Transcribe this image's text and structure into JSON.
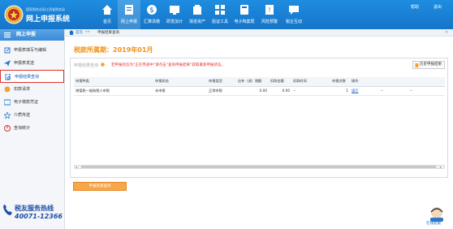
{
  "header": {
    "brand_subtitle": "国家税务总局江西省税务局",
    "brand_title": "网上申报系统",
    "nav": [
      {
        "label": "首页",
        "icon": "home-icon"
      },
      {
        "label": "网上申报",
        "icon": "file-icon"
      },
      {
        "label": "汇算清缴",
        "icon": "dollar-icon"
      },
      {
        "label": "研发加计",
        "icon": "research-icon"
      },
      {
        "label": "渐进资产",
        "icon": "asset-icon"
      },
      {
        "label": "验证工具",
        "icon": "tool-icon"
      },
      {
        "label": "电子档案局",
        "icon": "archive-icon"
      },
      {
        "label": "风险预警",
        "icon": "warning-icon"
      },
      {
        "label": "税企互动",
        "icon": "chat-icon"
      }
    ],
    "right_left": "帮助",
    "right_right": "退出"
  },
  "sidebar": {
    "title": "网上申报",
    "items": [
      {
        "label": "申报表填写与编辑",
        "icon": "edit-icon"
      },
      {
        "label": "申报表发送",
        "icon": "send-icon"
      },
      {
        "label": "申报结果查询",
        "icon": "search-doc-icon"
      },
      {
        "label": "扣款请求",
        "icon": "coin-icon"
      },
      {
        "label": "电子缴款凭证",
        "icon": "voucher-icon"
      },
      {
        "label": "介质传送",
        "icon": "media-icon"
      },
      {
        "label": "查询统计",
        "icon": "stats-icon"
      }
    ],
    "hotline_title": "税友服务热线",
    "hotline_number": "40071-12366"
  },
  "breadcrumb": {
    "home": "首页",
    "sep": "»»",
    "current": "申报结果查询",
    "close": "✕"
  },
  "main": {
    "period_label": "税款所属期：2019年01月",
    "box_title": "申报结果查询",
    "box_note": "若申报状态为“正在传递中”请点击“查询申报结果”获取最新申报状态。",
    "history_button": "历史申报结果",
    "query_button": "申报结果查询",
    "table": {
      "columns": [
        "申报种类",
        "申报状态",
        "申报类型",
        "应补（退）税额",
        "扣款金额",
        "扣款时间",
        "申报次数",
        "操作",
        "",
        ""
      ],
      "rows": [
        [
          "增值税一般纳税人申报",
          "未申报",
          "正常申报",
          "0.00",
          "0.00",
          "--",
          "1",
          "填写",
          "--",
          "--"
        ]
      ]
    }
  },
  "chat": {
    "label": "在线客服"
  },
  "colors": {
    "header_blue": "#1675c9",
    "accent_orange": "#f0901a",
    "alert_red": "#e0322b",
    "link_blue": "#1e5fc8"
  }
}
